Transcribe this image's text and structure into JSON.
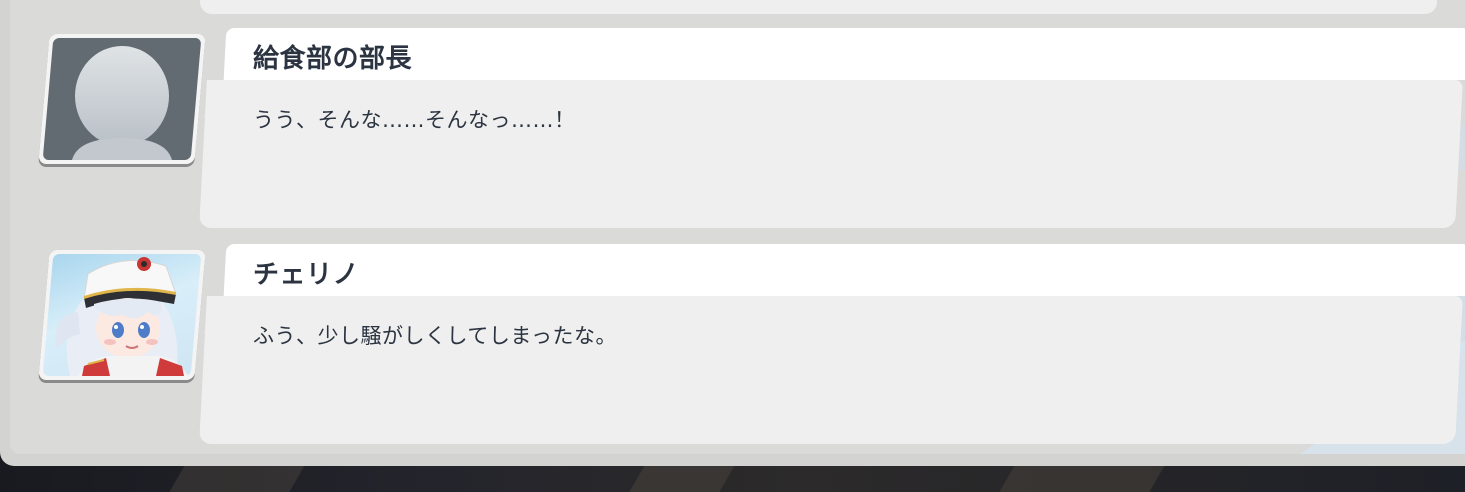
{
  "messages": [
    {
      "speaker": "給食部の部長",
      "text": "うう、そんな……そんなっ……！",
      "avatar": "silhouette-placeholder-icon"
    },
    {
      "speaker": "チェリノ",
      "text": "ふう、少し騒がしくしてしまったな。",
      "avatar": "cherino-portrait"
    }
  ],
  "colors": {
    "panel": "#d3d3d1",
    "bubble": "#efefef",
    "name_bar": "#ffffff",
    "text": "#2b3440",
    "background": "#1b1d24"
  }
}
